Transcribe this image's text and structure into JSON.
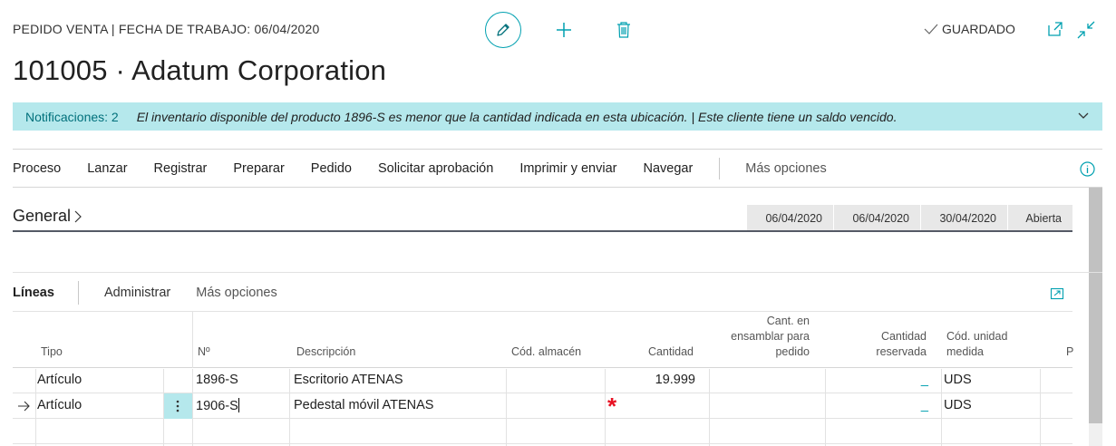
{
  "header": {
    "caption": "PEDIDO VENTA | FECHA DE TRABAJO: 06/04/2020",
    "saved_label": "GUARDADO",
    "title": "101005 · Adatum Corporation"
  },
  "notifications": {
    "count_label": "Notificaciones: 2",
    "message": "El inventario disponible del producto 1896-S es menor que la cantidad indicada en esta ubicación. | Este cliente tiene un saldo vencido."
  },
  "actions": [
    "Proceso",
    "Lanzar",
    "Registrar",
    "Preparar",
    "Pedido",
    "Solicitar aprobación",
    "Imprimir y enviar",
    "Navegar"
  ],
  "actions_more": "Más opciones",
  "general": {
    "label": "General",
    "summary": [
      "06/04/2020",
      "06/04/2020",
      "30/04/2020",
      "Abierta"
    ]
  },
  "lines": {
    "label": "Líneas",
    "manage": "Administrar",
    "more": "Más opciones",
    "columns": {
      "tipo": "Tipo",
      "no": "Nº",
      "descripcion": "Descripción",
      "almacen": "Cód. almacén",
      "cantidad": "Cantidad",
      "ensamblar": "Cant. en ensamblar para pedido",
      "reservada": "Cantidad reservada",
      "unidad": "Cód. unidad medida",
      "p": "P"
    },
    "rows": [
      {
        "tipo": "Artículo",
        "no": "1896-S",
        "descripcion": "Escritorio ATENAS",
        "almacen": "",
        "cantidad": "19.999",
        "reservada": "_",
        "unidad": "UDS"
      },
      {
        "tipo": "Artículo",
        "no": "1906-S",
        "descripcion": "Pedestal móvil ATENAS",
        "almacen": "",
        "cantidad": "",
        "required_mark": "*",
        "reservada": "_",
        "unidad": "UDS"
      }
    ]
  },
  "colors": {
    "accent": "#00a0b0",
    "notification_bg": "#b5e8ec",
    "required": "#e81123"
  }
}
